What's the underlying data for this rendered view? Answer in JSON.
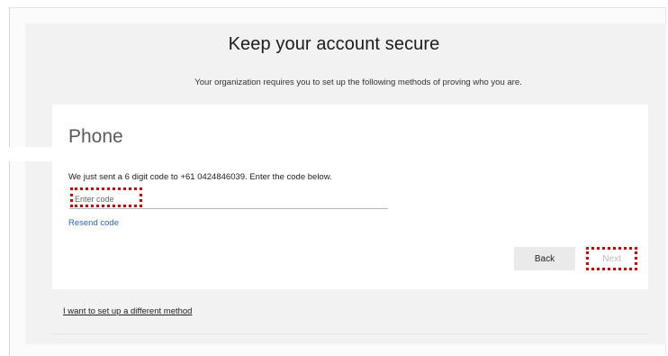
{
  "header": {
    "title": "Keep your account secure",
    "subtitle": "Your organization requires you to set up the following methods of proving who you are."
  },
  "card": {
    "title": "Phone",
    "instruction": "We just sent a 6 digit code to +61 0424846039. Enter the code below.",
    "code_input": {
      "placeholder": "Enter code",
      "value": ""
    },
    "resend_link": "Resend code",
    "back_label": "Back",
    "next_label": "Next"
  },
  "footer": {
    "different_method_link": "I want to set up a different method"
  },
  "colors": {
    "link": "#2b67c6",
    "highlight": "#d40000",
    "panel": "#f2f2f2"
  }
}
